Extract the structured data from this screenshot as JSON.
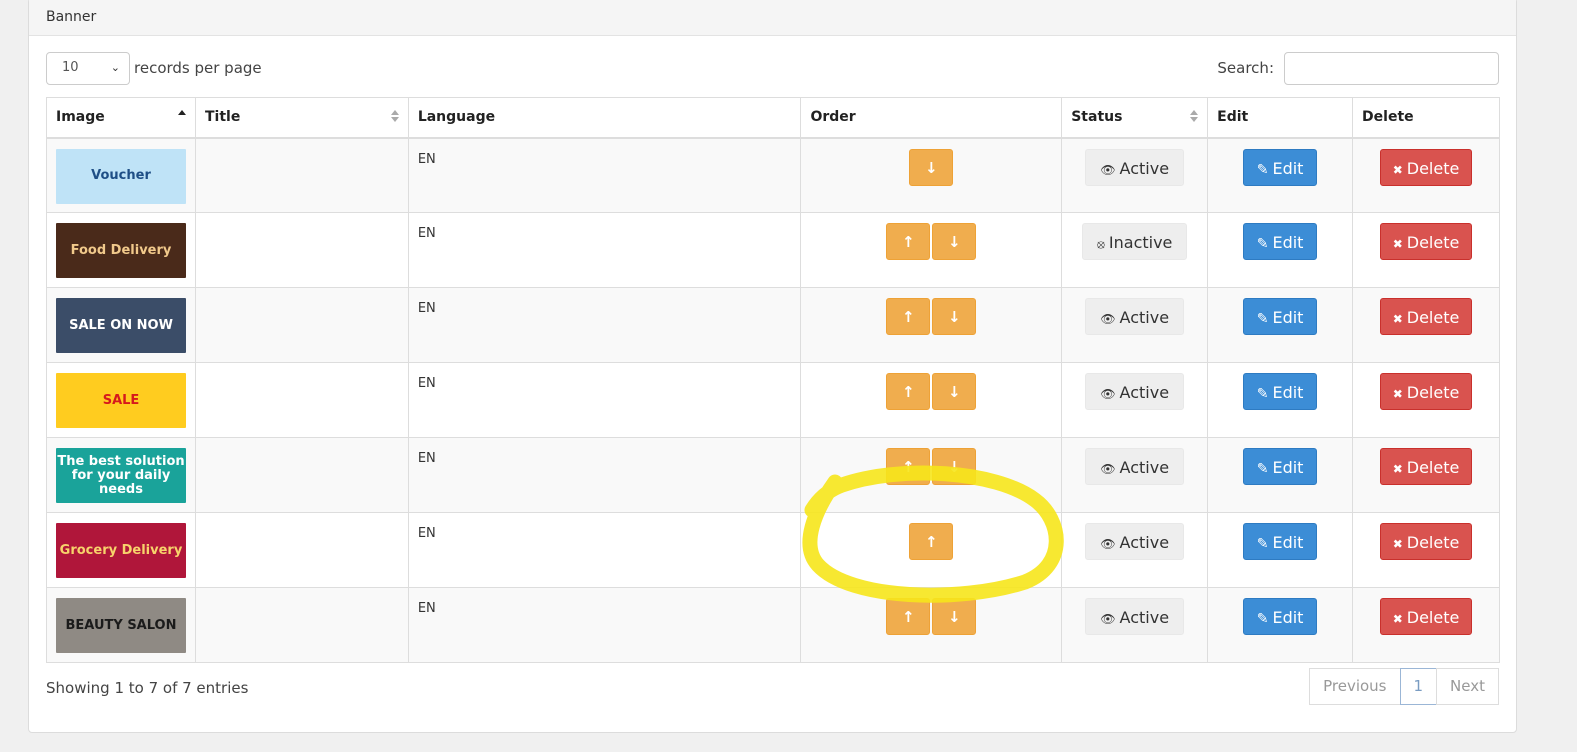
{
  "panel": {
    "title": "Banner"
  },
  "length_menu": {
    "value": "10",
    "label": "records per page"
  },
  "search": {
    "label": "Search:",
    "value": ""
  },
  "columns": [
    "Image",
    "Title",
    "Language",
    "Order",
    "Status",
    "Edit",
    "Delete"
  ],
  "rows": [
    {
      "banner_text": "Voucher",
      "title": "",
      "language": "EN",
      "order": [
        "down"
      ],
      "status": "Active",
      "status_icon": "eye-icon",
      "edit": "Edit",
      "delete": "Delete",
      "banner_bg": "#bfe3f7",
      "banner_fg": "#1f4f86"
    },
    {
      "banner_text": "Food Delivery",
      "title": "",
      "language": "EN",
      "order": [
        "up",
        "down"
      ],
      "status": "Inactive",
      "status_icon": "eye-slash-icon",
      "edit": "Edit",
      "delete": "Delete",
      "banner_bg": "#4a2a1a",
      "banner_fg": "#f1c98b"
    },
    {
      "banner_text": "SALE ON NOW",
      "title": "",
      "language": "EN",
      "order": [
        "up",
        "down"
      ],
      "status": "Active",
      "status_icon": "eye-icon",
      "edit": "Edit",
      "delete": "Delete",
      "banner_bg": "#3b4d68",
      "banner_fg": "#ffffff"
    },
    {
      "banner_text": "SALE",
      "title": "",
      "language": "EN",
      "order": [
        "up",
        "down"
      ],
      "status": "Active",
      "status_icon": "eye-icon",
      "edit": "Edit",
      "delete": "Delete",
      "banner_bg": "#ffcc1f",
      "banner_fg": "#d6191c"
    },
    {
      "banner_text": "The best solution for your daily needs",
      "title": "",
      "language": "EN",
      "order": [
        "up",
        "down"
      ],
      "status": "Active",
      "status_icon": "eye-icon",
      "edit": "Edit",
      "delete": "Delete",
      "banner_bg": "#1aa39a",
      "banner_fg": "#ffffff"
    },
    {
      "banner_text": "Grocery Delivery",
      "title": "",
      "language": "EN",
      "order": [
        "up"
      ],
      "status": "Active",
      "status_icon": "eye-icon",
      "edit": "Edit",
      "delete": "Delete",
      "banner_bg": "#b0163a",
      "banner_fg": "#f7d36b"
    },
    {
      "banner_text": "BEAUTY SALON",
      "title": "",
      "language": "EN",
      "order": [
        "up",
        "down"
      ],
      "status": "Active",
      "status_icon": "eye-icon",
      "edit": "Edit",
      "delete": "Delete",
      "banner_bg": "#8f8a84",
      "banner_fg": "#1b1b1b"
    }
  ],
  "footer": {
    "info": "Showing 1 to 7 of 7 entries"
  },
  "pagination": {
    "previous": "Previous",
    "current": "1",
    "next": "Next"
  },
  "colors": {
    "order_button": "#f0ad4e",
    "edit_button": "#3c8dd6",
    "delete_button": "#d9534f",
    "annotation": "#f6e51b"
  }
}
